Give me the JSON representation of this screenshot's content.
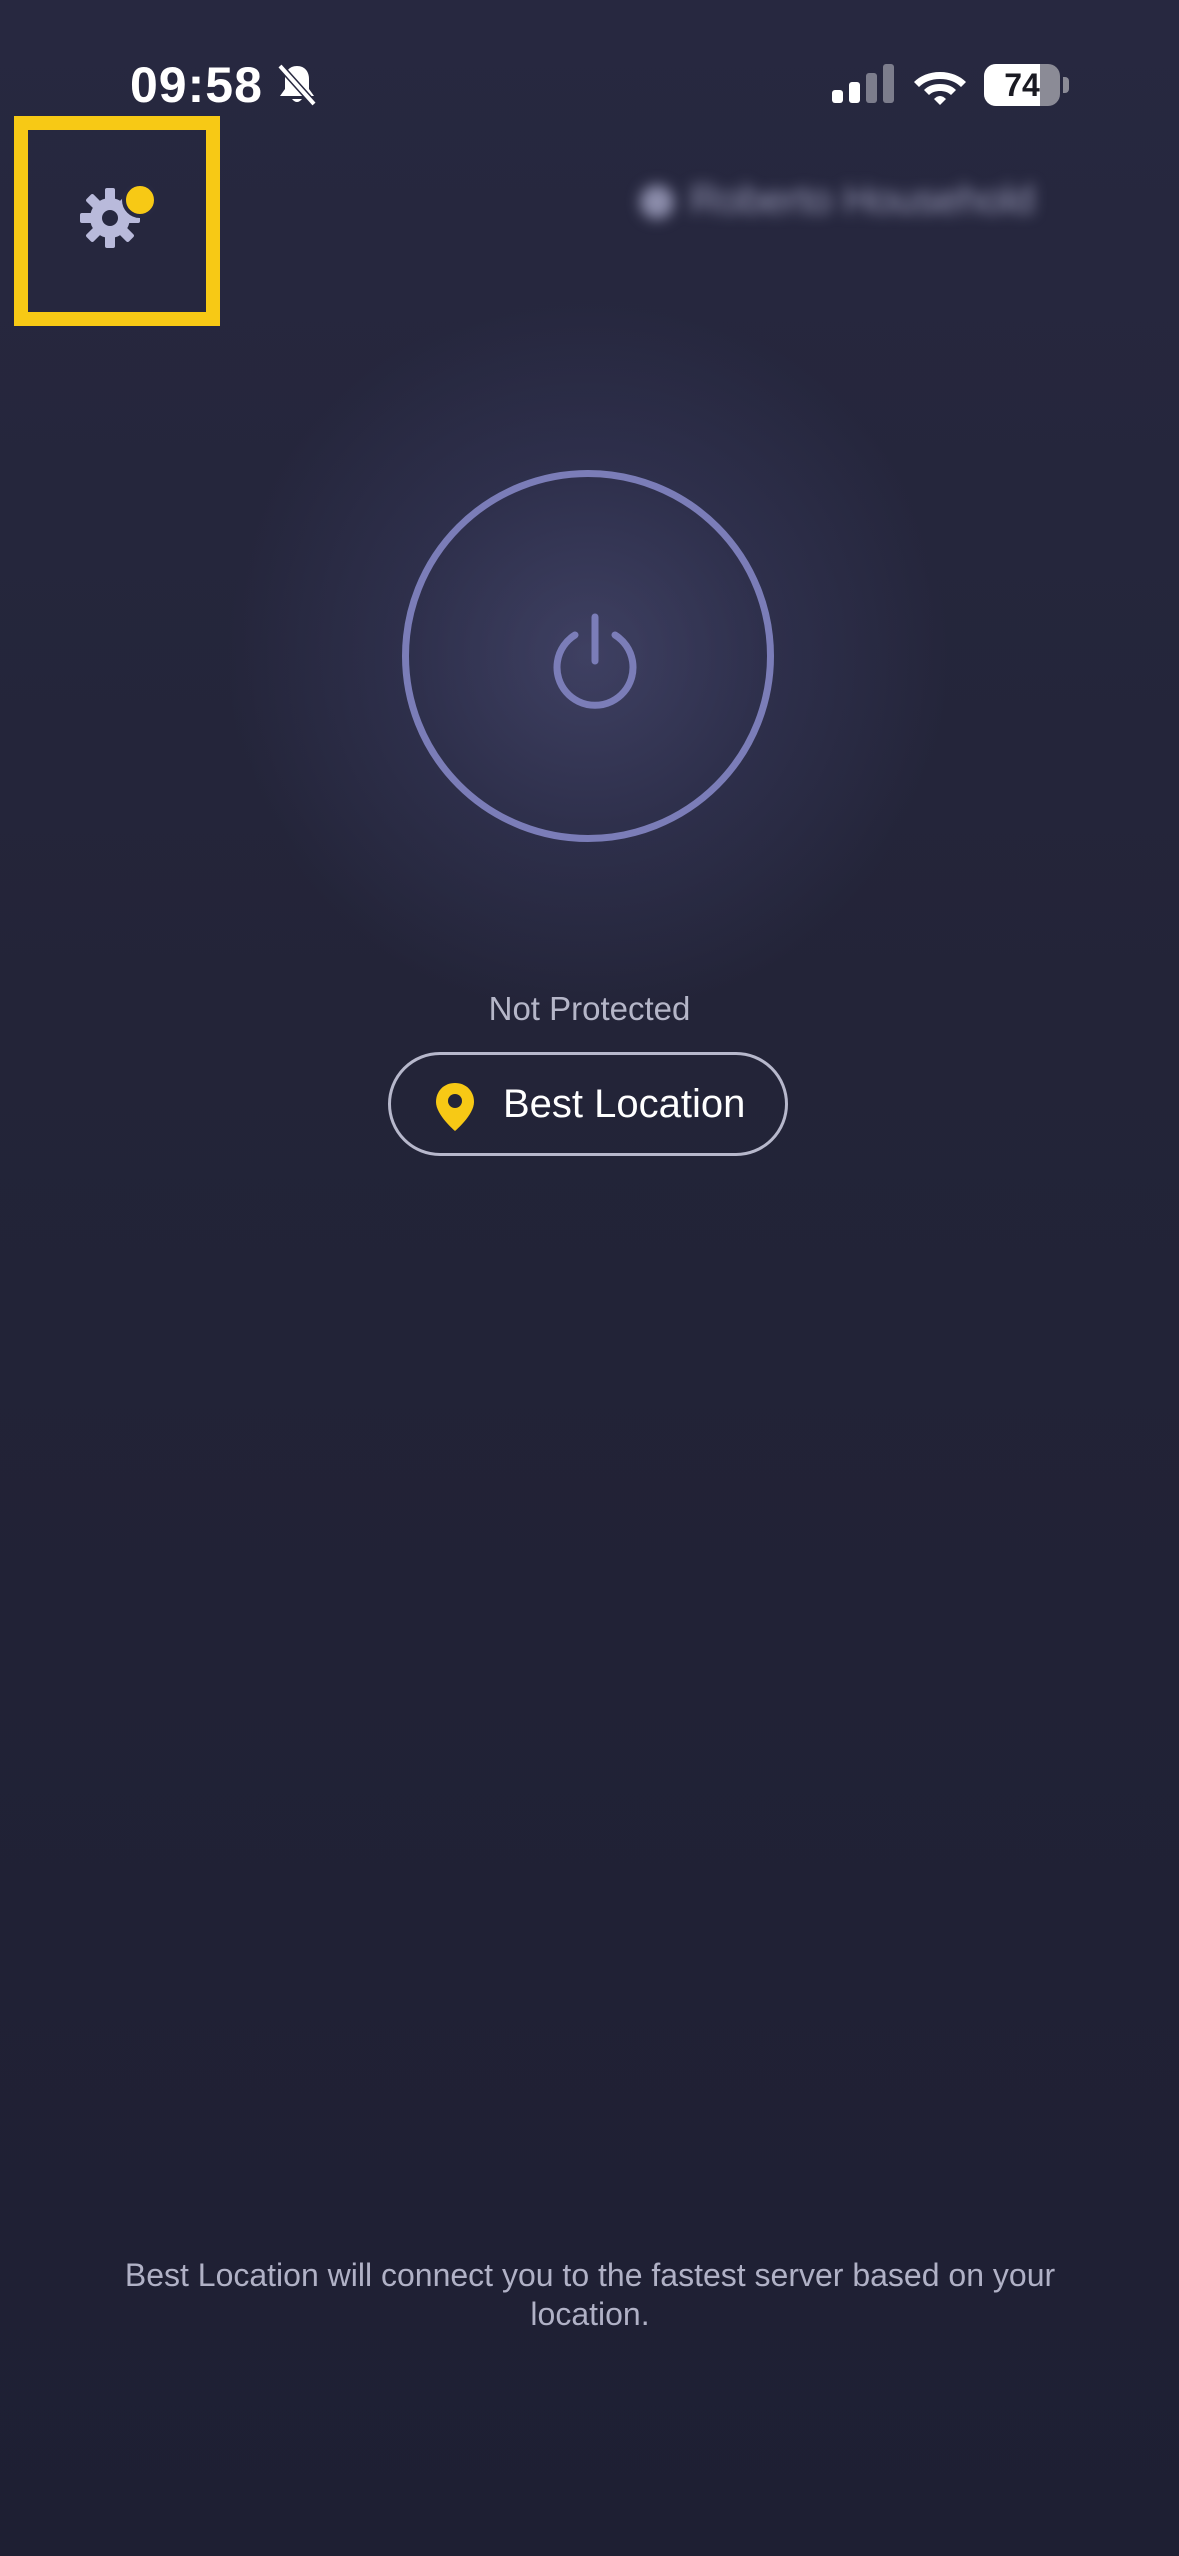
{
  "status_bar": {
    "time": "09:58",
    "battery_level": "74",
    "battery_fraction": 0.74,
    "icons": [
      "bell-slash-icon",
      "cellular-signal-icon",
      "wifi-icon",
      "battery-icon"
    ]
  },
  "header": {
    "settings_icon": "gear-icon",
    "settings_has_notification": true,
    "account_label": "Roberto Household"
  },
  "main": {
    "power_icon": "power-icon",
    "connection_status": "Not Protected",
    "location_label": "Best Location",
    "location_icon": "map-pin-icon"
  },
  "footer": {
    "note": "Best Location will connect you to the fastest server based on your location."
  },
  "colors": {
    "background": "#232439",
    "accent_yellow": "#f7c915",
    "power_ring": "#7b7db8",
    "text_secondary": "#b5b6c8"
  }
}
